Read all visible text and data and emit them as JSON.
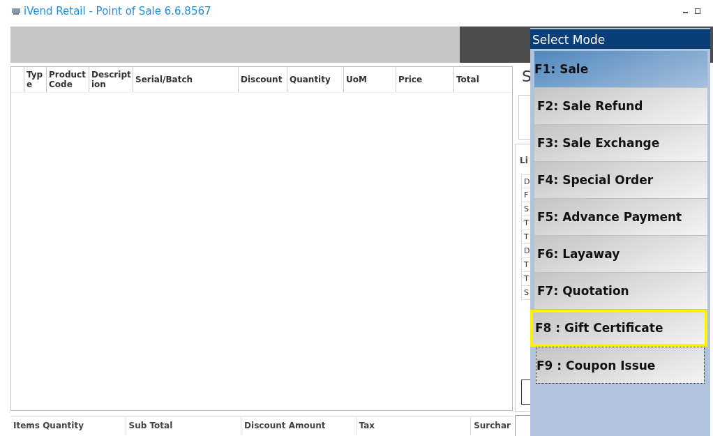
{
  "window": {
    "title": "iVend Retail - Point of Sale 6.6.8567"
  },
  "table": {
    "columns": [
      {
        "label": "Type"
      },
      {
        "label": "Product Code"
      },
      {
        "label": "Description"
      },
      {
        "label": "Serial/Batch"
      },
      {
        "label": "Discount"
      },
      {
        "label": "Quantity"
      },
      {
        "label": "UoM"
      },
      {
        "label": "Price"
      },
      {
        "label": "Total"
      }
    ]
  },
  "side_panel": {
    "heading": "S",
    "list_label": "Li",
    "list_rows": [
      "D",
      "F",
      "S",
      "T",
      "T",
      "D",
      "T",
      "T",
      "S"
    ]
  },
  "summary": {
    "columns": [
      "Items Quantity",
      "Sub Total",
      "Discount Amount",
      "Tax",
      "Surchar"
    ]
  },
  "mode_menu": {
    "title": "Select Mode",
    "items": [
      {
        "label": "F1: Sale",
        "selected": true,
        "highlighted": false,
        "focused": false
      },
      {
        "label": "F2: Sale Refund",
        "selected": false,
        "highlighted": false,
        "focused": false
      },
      {
        "label": "F3: Sale Exchange",
        "selected": false,
        "highlighted": false,
        "focused": false
      },
      {
        "label": "F4: Special Order",
        "selected": false,
        "highlighted": false,
        "focused": false
      },
      {
        "label": "F5: Advance Payment",
        "selected": false,
        "highlighted": false,
        "focused": false
      },
      {
        "label": "F6: Layaway",
        "selected": false,
        "highlighted": false,
        "focused": false
      },
      {
        "label": "F7: Quotation",
        "selected": false,
        "highlighted": false,
        "focused": false
      },
      {
        "label": "F8 : Gift Certificate",
        "selected": false,
        "highlighted": true,
        "focused": false
      },
      {
        "label": "F9 : Coupon Issue",
        "selected": false,
        "highlighted": false,
        "focused": true
      }
    ]
  }
}
